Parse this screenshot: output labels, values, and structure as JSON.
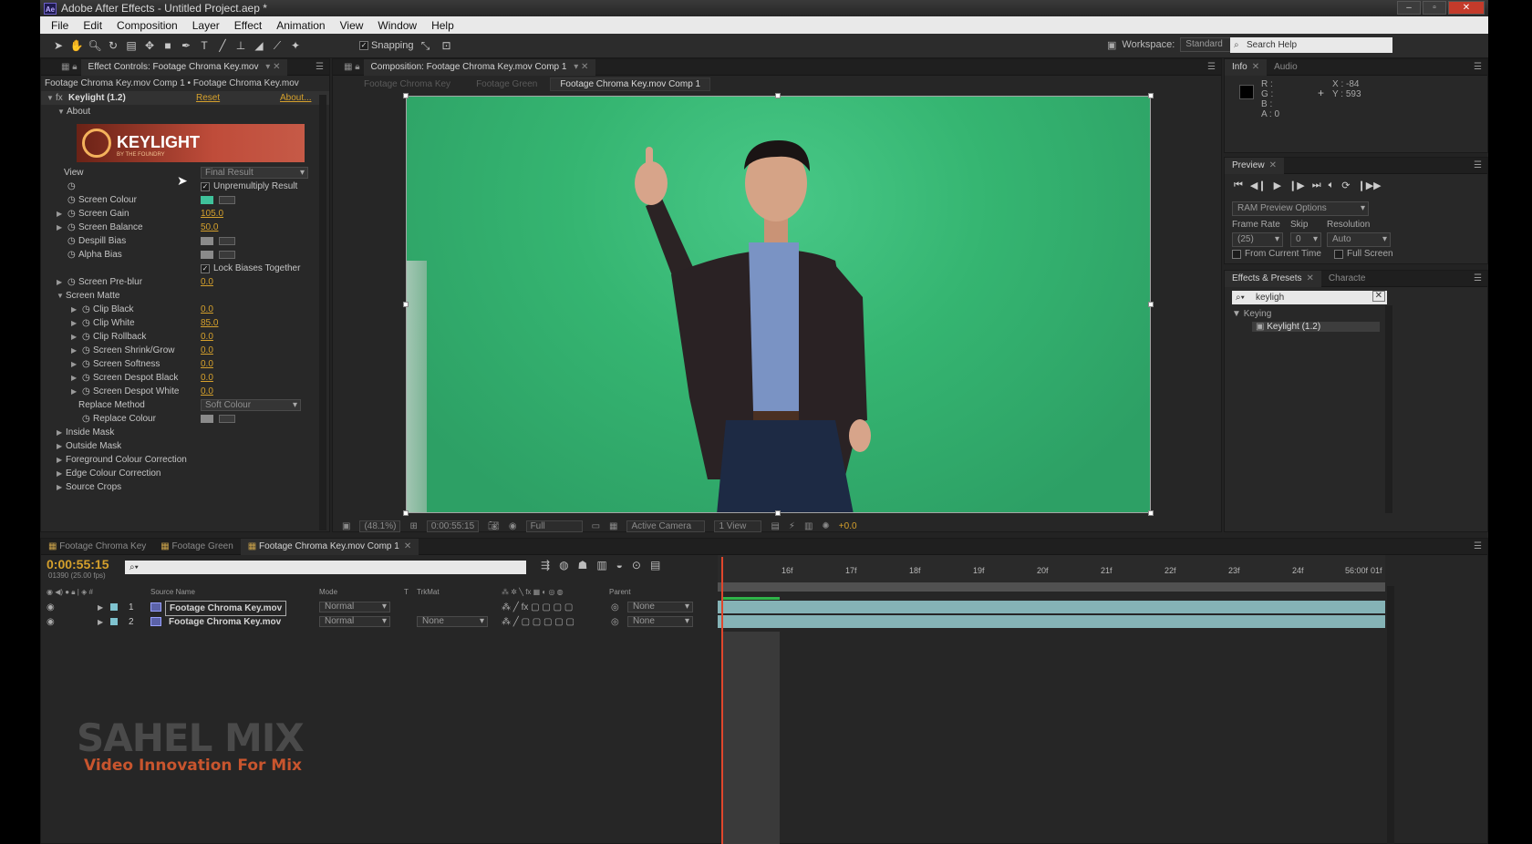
{
  "titlebar": {
    "title": "Adobe After Effects - Untitled Project.aep *",
    "logo_text": "Ae"
  },
  "menu": [
    "File",
    "Edit",
    "Composition",
    "Layer",
    "Effect",
    "Animation",
    "View",
    "Window",
    "Help"
  ],
  "toolbar": {
    "snapping_label": "Snapping",
    "workspace_label": "Workspace:",
    "workspace_value": "Standard",
    "search_placeholder": "Search Help"
  },
  "effect_controls": {
    "tab_label": "Effect Controls: Footage Chroma Key.mov",
    "path": "Footage Chroma Key.mov Comp 1 • Footage Chroma Key.mov",
    "effect_name": "Keylight (1.2)",
    "reset_label": "Reset",
    "about_label": "About...",
    "about_group": "About",
    "banner_text": "KEYLIGHT",
    "banner_sub": "BY THE FOUNDRY",
    "view_label": "View",
    "view_value": "Final Result",
    "unpremultiply_label": "Unpremultiply Result",
    "screen_colour_label": "Screen Colour",
    "screen_colour": "#3fc29b",
    "screen_gain_label": "Screen Gain",
    "screen_gain": "105.0",
    "screen_balance_label": "Screen Balance",
    "screen_balance": "50.0",
    "despill_bias_label": "Despill Bias",
    "alpha_bias_label": "Alpha Bias",
    "lock_biases_label": "Lock Biases Together",
    "screen_preblur_label": "Screen Pre-blur",
    "screen_preblur": "0.0",
    "screen_matte_label": "Screen Matte",
    "matte_params": [
      {
        "label": "Clip Black",
        "value": "0.0"
      },
      {
        "label": "Clip White",
        "value": "85.0"
      },
      {
        "label": "Clip Rollback",
        "value": "0.0"
      },
      {
        "label": "Screen Shrink/Grow",
        "value": "0.0"
      },
      {
        "label": "Screen Softness",
        "value": "0.0"
      },
      {
        "label": "Screen Despot Black",
        "value": "0.0"
      },
      {
        "label": "Screen Despot White",
        "value": "0.0"
      }
    ],
    "replace_method_label": "Replace Method",
    "replace_method_value": "Soft Colour",
    "replace_colour_label": "Replace Colour",
    "groups": [
      "Inside Mask",
      "Outside Mask",
      "Foreground Colour Correction",
      "Edge Colour Correction",
      "Source Crops"
    ]
  },
  "composition": {
    "tab_label": "Composition: Footage Chroma Key.mov Comp 1",
    "crumbs": [
      "Footage Chroma Key",
      "Footage Green",
      "Footage Chroma Key.mov Comp 1"
    ],
    "zoom": "(48.1%)",
    "timecode": "0:00:55:15",
    "resolution": "Full",
    "camera": "Active Camera",
    "views": "1 View",
    "exposure": "+0.0"
  },
  "info": {
    "tabs": [
      "Info",
      "Audio"
    ],
    "r": "R :",
    "g": "G :",
    "b": "B :",
    "a": "A : 0",
    "x": "X : -84",
    "y": "Y : 593"
  },
  "preview": {
    "tab_label": "Preview",
    "ram_options": "RAM Preview Options",
    "frame_rate_label": "Frame Rate",
    "skip_label": "Skip",
    "resolution_label": "Resolution",
    "frame_rate": "(25)",
    "skip": "0",
    "resolution": "Auto",
    "from_current_label": "From Current Time",
    "full_screen_label": "Full Screen"
  },
  "presets": {
    "tabs": [
      "Effects & Presets",
      "Characte"
    ],
    "search": "keyligh",
    "category": "Keying",
    "item": "Keylight (1.2)"
  },
  "timeline": {
    "tabs": [
      "Footage Chroma Key",
      "Footage Green",
      "Footage Chroma Key.mov Comp 1"
    ],
    "timecode": "0:00:55:15",
    "fps": "01390 (25.00 fps)",
    "search_placeholder": "",
    "col_source": "Source Name",
    "col_mode": "Mode",
    "col_t": "T",
    "col_trkmat": "TrkMat",
    "col_parent": "Parent",
    "ticks": [
      "16f",
      "17f",
      "18f",
      "19f",
      "20f",
      "21f",
      "22f",
      "23f",
      "24f",
      "56:00f",
      "01f"
    ],
    "layers": [
      {
        "num": "1",
        "name": "Footage Chroma Key.mov",
        "mode": "Normal",
        "trkmat": "",
        "parent": "None"
      },
      {
        "num": "2",
        "name": "Footage Chroma Key.mov",
        "mode": "Normal",
        "trkmat": "None",
        "parent": "None"
      }
    ]
  },
  "watermark": {
    "line1": "SAHEL MIX",
    "line2": "Video Innovation For Mix"
  }
}
